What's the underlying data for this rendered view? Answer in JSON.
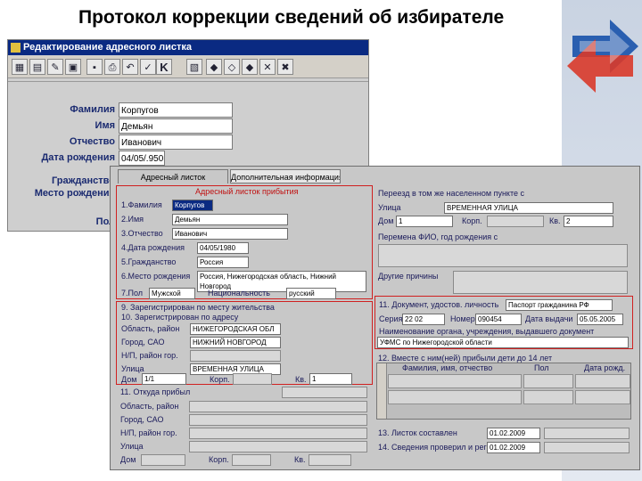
{
  "slide": {
    "title": "Протокол коррекции сведений об избирателе"
  },
  "window": {
    "title": "Редактирование адресного листка"
  },
  "toolbar": {
    "k_label": "K"
  },
  "back_form": {
    "labels": {
      "surname": "Фамилия",
      "name": "Имя",
      "patronymic": "Отчество",
      "birthdate": "Дата рождения",
      "citizenship": "Гражданство",
      "birthplace": "Место рождения",
      "pol": "Пол"
    },
    "values": {
      "surname": "Корпугов",
      "name": "Демьян",
      "patronymic": "Иванович",
      "birthdate": "04/05/.950"
    }
  },
  "tabs": [
    "Адресный листок",
    "Дополнительная информация"
  ],
  "arrival": {
    "header": "Адресный листок прибытия",
    "surname_label": "1.Фамилия",
    "surname": "Корпугов",
    "name_label": "2.Имя",
    "name": "Демьян",
    "patronymic_label": "3.Отчество",
    "patronymic": "Иванович",
    "birthdate_label": "4.Дата рождения",
    "birthdate": "04/05/1980",
    "citizenship_label": "5.Гражданство",
    "citizenship": "Россия",
    "birthplace_label": "6.Место рождения",
    "birthplace_line1": "Россия, Нижегородская область, Нижний",
    "birthplace_line2": "Новгород",
    "sex_label": "7.Пол",
    "sex": "Мужской",
    "nationality_label": "Национальность",
    "nationality": "русский"
  },
  "residence": {
    "line9": "9. Зарегистрирован по месту жительства",
    "line10": "10. Зарегистрирован по адресу",
    "region_label": "Область, район",
    "region": "НИЖЕГОРОДСКАЯ ОБЛ",
    "city_label": "Город, САО",
    "city": "НИЖНИЙ НОВГОРОД",
    "np_label": "Н/П, район гор.",
    "street_label": "Улица",
    "street": "ВРЕМЕННАЯ УЛИЦА",
    "house_label": "Дом",
    "house": "1/1",
    "korp_label": "Корп.",
    "kv_label": "Кв.",
    "kv": "1"
  },
  "departure": {
    "line11": "11. Откуда прибыл",
    "region_label": "Область, район",
    "city_label": "Город, САО",
    "np_label": "Н/П, район гор.",
    "street_label": "Улица",
    "house_label": "Дом",
    "korp_label": "Корп.",
    "kv_label": "Кв."
  },
  "moved": {
    "header": "Переезд в том же населенном пункте с",
    "street_label": "Улица",
    "street": "ВРЕМЕННАЯ УЛИЦА",
    "house_label": "Дом",
    "house": "1",
    "korp_label": "Корп.",
    "kv_label": "Кв.",
    "kv": "2"
  },
  "change_header": "Перемена ФИО, год рождения с",
  "other_reasons": "Другие причины",
  "document": {
    "line11": "11. Документ, удостов. личность",
    "doc": "Паспорт гражданина РФ",
    "series_label": "Серия",
    "series": "22 02",
    "number_label": "Номер",
    "number": "090454",
    "issue_label": "Дата выдачи",
    "issue": "05.05.2005",
    "org_label": "Наименование органа, учреждения, выдавшего документ",
    "org": "УФМС по Нижегородской области"
  },
  "children": {
    "header": "12. Вместе с ним(ней) прибыли дети до 14 лет",
    "col1": "Фамилия, имя, отчество",
    "col2": "Пол",
    "col3": "Дата рожд."
  },
  "footer": {
    "line13_label": "13. Листок составлен",
    "line13": "01.02.2009",
    "line14_label": "14. Сведения проверил и рег",
    "line14": "01.02.2009"
  },
  "colors": {
    "title_bar": "#0a2a82",
    "section_border": "#d02020",
    "label_text": "#1a2a70"
  }
}
